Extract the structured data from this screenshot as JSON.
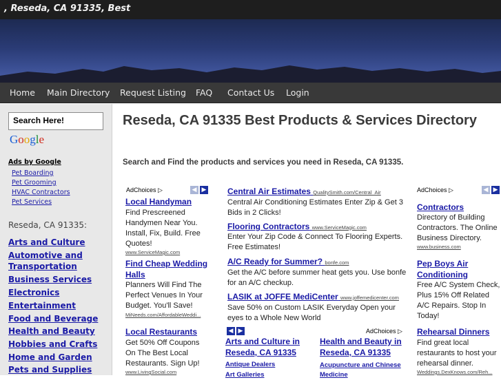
{
  "header": {
    "site_title": ", Reseda, CA 91335, Best"
  },
  "nav": {
    "items": [
      "Home",
      "Main Directory",
      "Request Listing",
      "FAQ",
      "Contact Us",
      "Login"
    ]
  },
  "sidebar": {
    "search_label": "Search Here!",
    "google_logo": [
      "G",
      "o",
      "o",
      "g",
      "l",
      "e"
    ],
    "ads_by": "Ads by Google",
    "ads": [
      "Pet Boarding",
      "Pet Grooming",
      "HVAC Contractors",
      "Pet Services"
    ],
    "heading": "Reseda, CA 91335:",
    "categories": [
      "Arts and Culture",
      "Automotive and Transportation",
      "Business Services",
      "Electronics",
      "Entertainment",
      "Food and Beverage",
      "Health and Beauty",
      "Hobbies and Crafts",
      "Home and Garden",
      "Pets and Supplies"
    ]
  },
  "main": {
    "title": "Reseda, CA 91335 Best Products & Services Directory",
    "intro": "Search and Find the products and services you need in Reseda, CA 91335.",
    "adchoices": "AdChoices",
    "left_ads": [
      {
        "title": "Local Handyman",
        "body": "Find Prescreened Handymen Near You. Install, Fix, Build. Free Quotes!",
        "url": "www.ServiceMagic.com"
      },
      {
        "title": "Find Cheap Wedding Halls",
        "body": "Planners Will Find The Perfect Venues In Your Budget. You'll Save!",
        "url": "MiNeeds.com/AffordableWeddi..."
      },
      {
        "title": "Local Restaurants",
        "body": "Get 50% Off Coupons On The Best Local Restaurants. Sign Up!",
        "url": "www.LivingSocial.com"
      }
    ],
    "center_ads": [
      {
        "title": "Central Air Estimates",
        "url": "QualitySmith.com/Central_Air",
        "body": "Central Air Conditioning Estimates Enter Zip & Get 3 Bids in 2 Clicks!"
      },
      {
        "title": "Flooring Contractors",
        "url": "www.ServiceMagic.com",
        "body": "Enter Your Zip Code & Connect To Flooring Experts. Free Estimates!"
      },
      {
        "title": "A/C Ready for Summer?",
        "url": "bonfe.com",
        "body": "Get the A/C before summer heat gets you. Use bonfe for an A/C checkup."
      },
      {
        "title": "LASIK at JOFFE MediCenter",
        "url": "www.joffemedicenter.com",
        "body": "Save 50% on Custom LASIK Everyday Open your eyes to a Whole New World"
      }
    ],
    "right_ads": [
      {
        "title": "Contractors",
        "body": "Directory of Building Contractors. The Online Business Directory.",
        "url": "www.business.com"
      },
      {
        "title": "Pep Boys Air Conditioning",
        "body": "Free A/C System Check, Plus 15% Off Related A/C Repairs. Stop In Today!",
        "url": ""
      },
      {
        "title": "Rehearsal Dinners",
        "body": "Find great local restaurants to host your rehearsal dinner.",
        "url": "Weddings.DexKnows.com/Reh..."
      }
    ],
    "bottom_blocks": [
      {
        "title": "Arts and Culture in Reseda, CA 91335",
        "link1": "Antique Dealers",
        "link2": "Art Galleries"
      },
      {
        "title": "Health and Beauty in Reseda, CA 91335",
        "link1": "Acupuncture and Chinese Medicine",
        "link2": ""
      }
    ]
  },
  "colors": {
    "link": "#1a1aa6",
    "nav_bg": "#393939",
    "sidebar_bg": "#e8e8e8"
  }
}
